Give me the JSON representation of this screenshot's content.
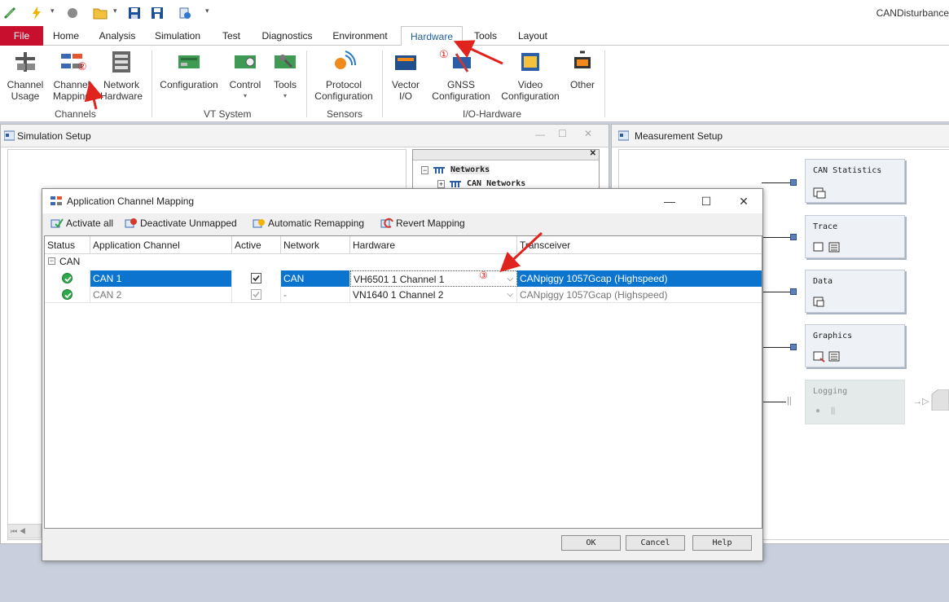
{
  "app": {
    "title": "CANDisturbance"
  },
  "tabs": [
    "File",
    "Home",
    "Analysis",
    "Simulation",
    "Test",
    "Diagnostics",
    "Environment",
    "Hardware",
    "Tools",
    "Layout"
  ],
  "ribbon": {
    "channels": {
      "label": "Channels",
      "buttons": [
        "Channel\nUsage",
        "Channel\nMapping",
        "Network\nHardware"
      ]
    },
    "vt_system": {
      "label": "VT System",
      "buttons": [
        "Configuration",
        "Control",
        "Tools"
      ]
    },
    "sensors": {
      "label": "Sensors",
      "buttons": [
        "Protocol\nConfiguration"
      ]
    },
    "io_hardware": {
      "label": "I/O-Hardware",
      "buttons": [
        "Vector\nI/O",
        "GNSS\nConfiguration",
        "Video\nConfiguration",
        "Other"
      ]
    }
  },
  "annotations": {
    "marker1": "①",
    "marker2": "②",
    "marker3": "③"
  },
  "simulation_setup": {
    "title": "Simulation Setup",
    "tree": {
      "root": "Networks",
      "child": "CAN Networks"
    }
  },
  "measurement_setup": {
    "title": "Measurement Setup",
    "blocks": [
      "CAN Statistics",
      "Trace",
      "Data",
      "Graphics",
      "Logging"
    ]
  },
  "dialog": {
    "title": "Application Channel Mapping",
    "toolbar": [
      "Activate all",
      "Deactivate Unmapped",
      "Automatic Remapping",
      "Revert Mapping"
    ],
    "columns": [
      "Status",
      "Application Channel",
      "Active",
      "Network",
      "Hardware",
      "Transceiver"
    ],
    "group": "CAN",
    "rows": [
      {
        "channel": "CAN 1",
        "active": true,
        "network": "CAN",
        "hardware": "VH6501 1 Channel 1",
        "transceiver": "CANpiggy 1057Gcap (Highspeed)",
        "selected": true
      },
      {
        "channel": "CAN 2",
        "active": true,
        "network": "-",
        "hardware": "VN1640 1 Channel 2",
        "transceiver": "CANpiggy 1057Gcap (Highspeed)",
        "selected": false
      }
    ],
    "buttons": {
      "ok": "OK",
      "cancel": "Cancel",
      "help": "Help"
    }
  },
  "colors": {
    "file_tab": "#c8102e",
    "selection": "#0a74cf",
    "status_ok": "#2ea84a",
    "annotation": "#e0231c"
  }
}
